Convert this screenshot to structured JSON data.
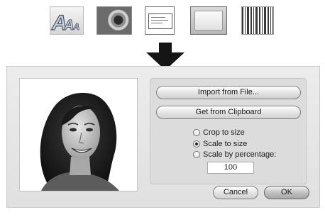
{
  "sources": {
    "items": [
      {
        "icon": "text-style-icon"
      },
      {
        "icon": "photo-icon"
      },
      {
        "icon": "label-icon"
      },
      {
        "icon": "frame-icon"
      },
      {
        "icon": "barcode-icon"
      }
    ]
  },
  "arrow": {
    "icon": "down-arrow-icon"
  },
  "dialog": {
    "preview_icon": "portrait-photo",
    "import_button": "Import from File...",
    "clipboard_button": "Get from Clipboard",
    "options": [
      {
        "label": "Crop to size",
        "selected": false
      },
      {
        "label": "Scale to size",
        "selected": true
      },
      {
        "label": "Scale by percentage:",
        "selected": false
      }
    ],
    "percentage_value": "100",
    "cancel_button": "Cancel",
    "ok_button": "OK"
  }
}
